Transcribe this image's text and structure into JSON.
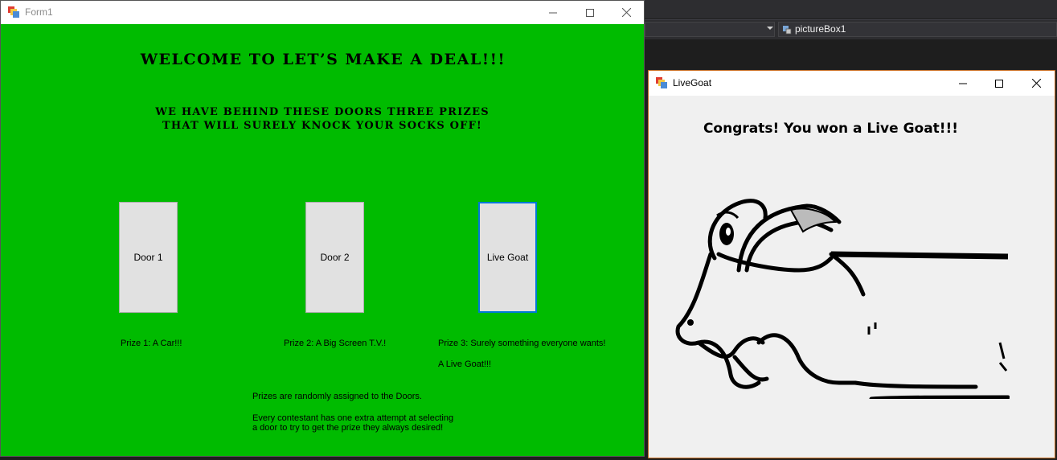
{
  "ide": {
    "combo_label": "pictureBox1",
    "combo_icon": "component-icon"
  },
  "form1": {
    "title": "Form1",
    "heading": "WELCOME TO LET’S MAKE A DEAL!!!",
    "subheading_line1": "WE HAVE BEHIND THESE DOORS THREE PRIZES",
    "subheading_line2": "THAT WILL SURELY KNOCK YOUR SOCKS OFF!",
    "background_color": "#00bb00",
    "doors": [
      {
        "label": "Door 1"
      },
      {
        "label": "Door 2"
      },
      {
        "label": "Live Goat"
      }
    ],
    "prizes": {
      "prize1": "Prize 1: A Car!!!",
      "prize2": "Prize 2: A Big Screen T.V.!",
      "prize3": "Prize 3: Surely something everyone wants!",
      "prize3_detail": "A Live Goat!!!"
    },
    "info_line1": "Prizes are randomly assigned to the Doors.",
    "info_line2": "Every contestant has one extra attempt at selecting",
    "info_line3": "a door to try to get the prize they always desired!"
  },
  "livegoat": {
    "title": "LiveGoat",
    "message": "Congrats! You won a Live Goat!!!",
    "picture": "goat-drawing"
  },
  "window_controls": [
    "minimize-icon",
    "maximize-icon",
    "close-icon"
  ]
}
